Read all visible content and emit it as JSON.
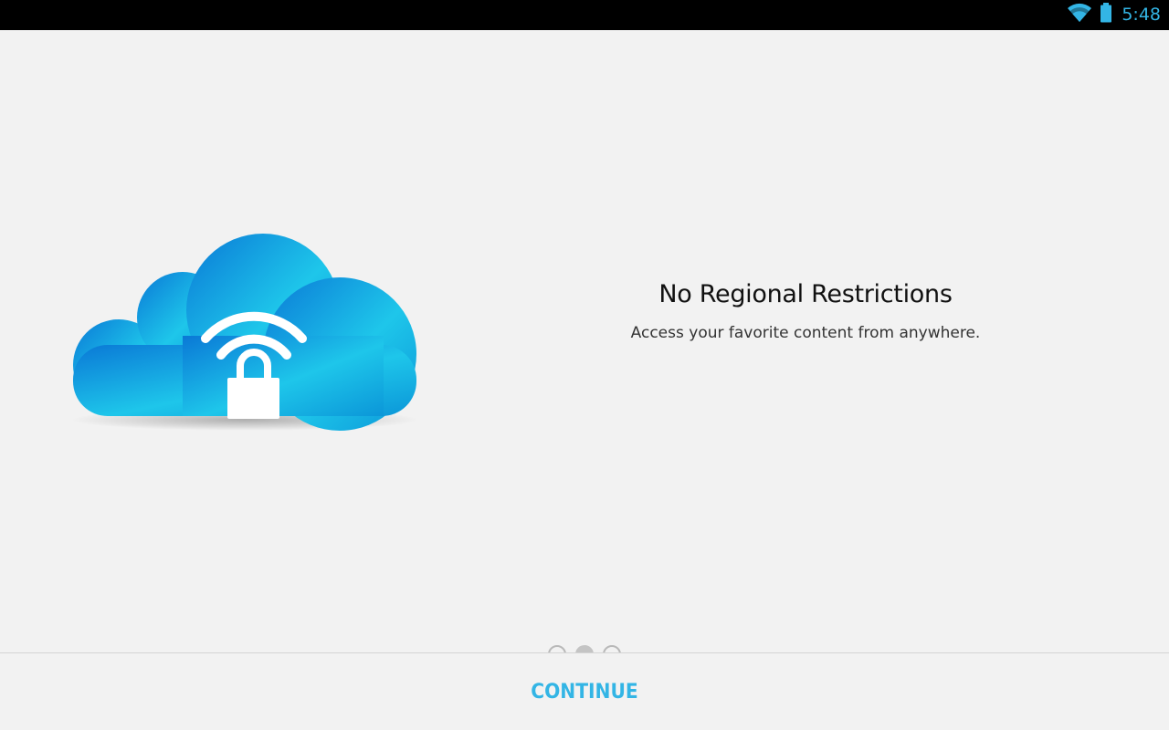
{
  "status_bar": {
    "time": "5:48",
    "icons": [
      "wifi-icon",
      "battery-icon"
    ],
    "accent_color": "#33b5e5"
  },
  "onboarding": {
    "title": "No Regional Restrictions",
    "subtitle": "Access your favorite content from anywhere.",
    "illustration": "cloud-lock-wifi-icon",
    "page_indicator": {
      "total": 3,
      "current": 2
    }
  },
  "footer": {
    "continue_label": "CONTINUE",
    "accent_color": "#33b5e5"
  }
}
